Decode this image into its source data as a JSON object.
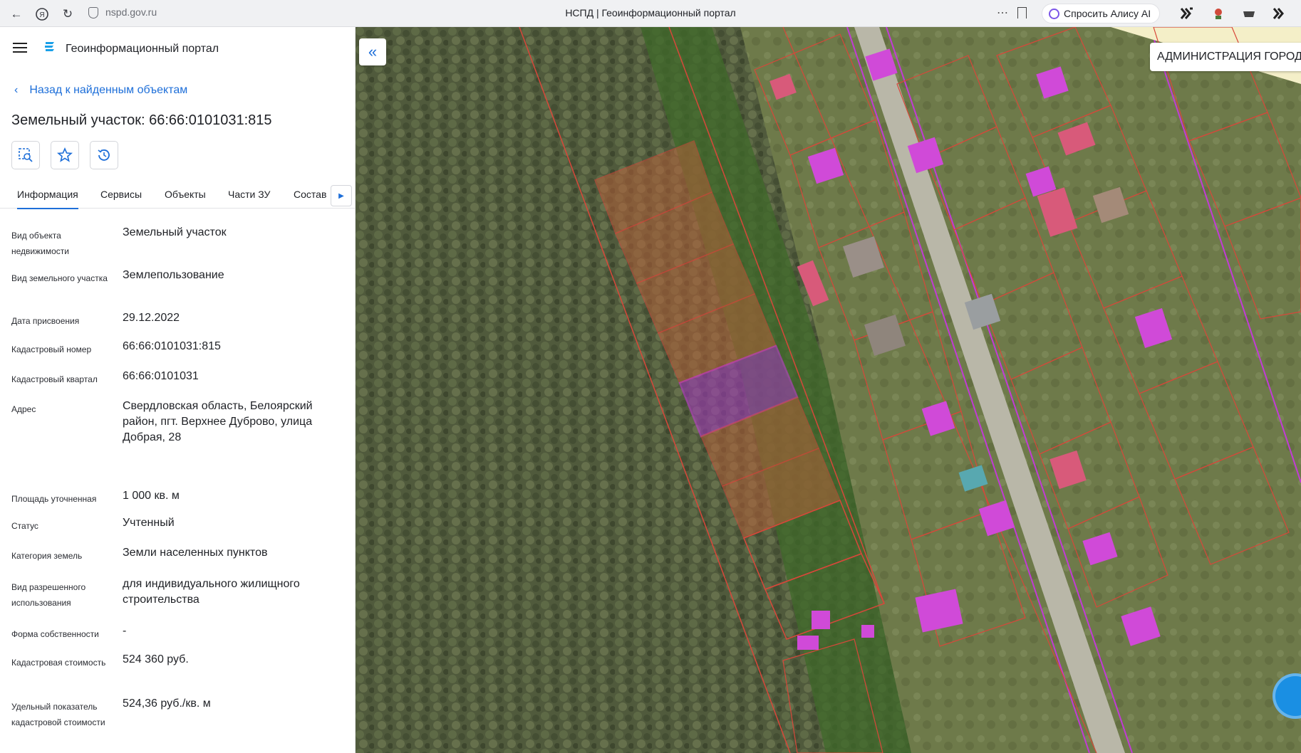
{
  "browser": {
    "url": "nspd.gov.ru",
    "tab_title": "НСПД | Геоинформационный портал",
    "alice_label": "Спросить Алису AI"
  },
  "header": {
    "portal_title": "Геоинформационный портал"
  },
  "back_link": "Назад к найденным объектам",
  "object_title": "Земельный участок: 66:66:0101031:815",
  "tabs": [
    "Информация",
    "Сервисы",
    "Объекты",
    "Части ЗУ",
    "Состав"
  ],
  "info": [
    {
      "label": "Вид объекта недвижимости",
      "value": "Земельный участок"
    },
    {
      "label": "Вид земельного участка",
      "value": "Землепользование"
    },
    {
      "label": "Дата присвоения",
      "value": "29.12.2022"
    },
    {
      "label": "Кадастровый номер",
      "value": "66:66:0101031:815"
    },
    {
      "label": "Кадастровый квартал",
      "value": "66:66:0101031"
    },
    {
      "label": "Адрес",
      "value": "Свердловская область, Белоярский район, пгт. Верхнее Дуброво, улица Добрая, 28"
    },
    {
      "label": "Площадь уточненная",
      "value": "1 000 кв. м"
    },
    {
      "label": "Статус",
      "value": "Учтенный"
    },
    {
      "label": "Категория земель",
      "value": "Земли населенных пунктов"
    },
    {
      "label": "Вид разрешенного использования",
      "value": "для индивидуального жилищного строительства"
    },
    {
      "label": "Форма собственности",
      "value": "-"
    },
    {
      "label": "Кадастровая стоимость",
      "value": "524 360 руб."
    },
    {
      "label": "Удельный показатель кадастровой стоимости",
      "value": "524,36 руб./кв. м"
    }
  ],
  "map": {
    "admin_label": "АДМИНИСТРАЦИЯ ГОРОД"
  },
  "colors": {
    "accent": "#1e6fd9",
    "parcel_line": "#d8473a",
    "selected_parcel": "#c23bd6",
    "building": "#d04ad8"
  },
  "icons": [
    "back-icon",
    "yandex-icon",
    "reload-icon",
    "shield-icon",
    "bookmark-icon",
    "alice-icon",
    "menu-icon",
    "portal-logo-icon",
    "search-area-icon",
    "star-icon",
    "history-icon",
    "chevron-right-icon",
    "collapse-icon",
    "chat-icon"
  ]
}
